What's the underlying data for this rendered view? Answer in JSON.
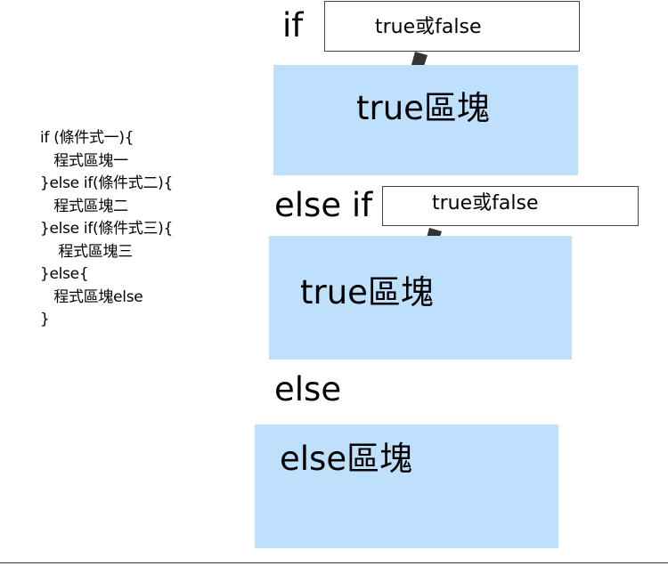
{
  "code": {
    "lines": [
      "if (條件式一){",
      "   程式區塊一",
      "}else if(條件式二){",
      "   程式區塊二",
      "}else if(條件式三){",
      "    程式區塊三",
      "}else{",
      "   程式區塊else",
      "}"
    ]
  },
  "diagram": {
    "if_keyword": "if",
    "if_condition": "true或false",
    "if_block": "true區塊",
    "elseif_keyword": "else if",
    "elseif_condition": "true或false",
    "elseif_block": "true區塊",
    "else_keyword": "else",
    "else_block": "else區塊"
  },
  "colors": {
    "block_fill": "#bfe0fc",
    "connector": "#333333",
    "box_border": "#444444"
  },
  "icons": {
    "connector": "brush-stroke-connector-icon"
  }
}
